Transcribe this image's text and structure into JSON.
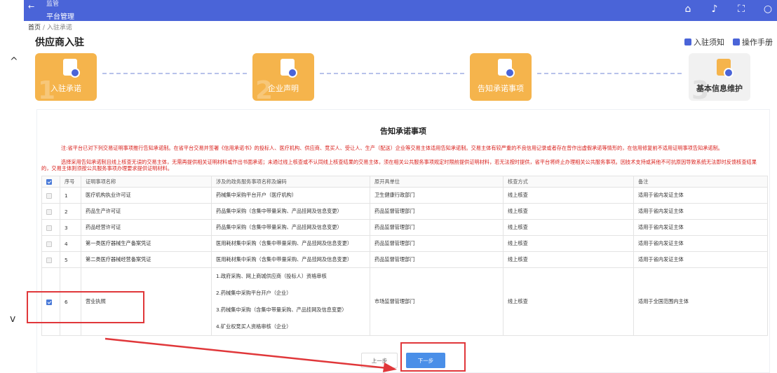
{
  "header": {
    "back_icon": "arrow-left-icon",
    "system_top": "监管",
    "system_name": "平台管理",
    "tools": [
      "home-icon",
      "bell-icon",
      "fullscreen-icon",
      "search-icon"
    ]
  },
  "breadcrumb": {
    "home": "首页",
    "sep": "/",
    "current": "入驻承诺"
  },
  "page_title": "供应商入驻",
  "links": [
    {
      "label": "入驻须知",
      "icon": "notice-icon"
    },
    {
      "label": "操作手册",
      "icon": "manual-icon"
    }
  ],
  "steps": [
    {
      "num": "1",
      "label": "入驻承诺",
      "icon": "commitment-icon"
    },
    {
      "num": "2",
      "label": "企业声明",
      "icon": "enterprise-icon"
    },
    {
      "num": "",
      "label": "告知承诺事项",
      "icon": "bookmark-doc-icon"
    },
    {
      "num": "3",
      "label": "基本信息维护",
      "icon": "info-doc-icon"
    }
  ],
  "card": {
    "title": "告知承诺事项",
    "notice_1": "注:省平台已对下列交易证明事项推行告知承诺制。在省平台交易并签署《信用承诺书》的投标人、医疗机构、供应商、竞买人、受让人、生产（配送）企业等交易主体适用告知承诺制。交易主体有较严重的不良信用记录或者存在曾作出虚假承诺等情形的，在信用修复前不适用证明事项告知承诺制。",
    "notice_2": "选择采用告知承诺制且线上核查无误的交易主体，无需再提供相关证明材料或作出书面承诺；未通过线上核查或不认同线上核查结果的交易主体，须在相关公共服务事项规定时限前提供证明材料，若无法按时提供，省平台将终止办理相关公共服务事项。因技术支持或其他不可抗原因导致系统无法即时反馈核查结果的，交易主体则须按公共服务事项办理要求提供证明材料。"
  },
  "table": {
    "headers": [
      "序号",
      "证明事项名称",
      "涉及的政务服务事项名称及编码",
      "原开具单位",
      "核查方式",
      "备注"
    ],
    "rows": [
      {
        "no": "1",
        "name": "医疗机构执业许可证",
        "items": [
          "药械集中采购平台开户（医疗机构）"
        ],
        "unit": "卫生健康行政部门",
        "method": "线上核查",
        "remark": "适用于省内发证主体",
        "checked": false
      },
      {
        "no": "2",
        "name": "药品生产许可证",
        "items": [
          "药品集中采购（含集中带量采购、产品挂网及信息变更）"
        ],
        "unit": "药品监督管理部门",
        "method": "线上核查",
        "remark": "适用于省内发证主体",
        "checked": false
      },
      {
        "no": "3",
        "name": "药品经营许可证",
        "items": [
          "药品集中采购（含集中带量采购、产品挂网及信息变更）"
        ],
        "unit": "药品监督管理部门",
        "method": "线上核查",
        "remark": "适用于省内发证主体",
        "checked": false
      },
      {
        "no": "4",
        "name": "第一类医疗器械生产备案凭证",
        "items": [
          "医用耗材集中采购（含集中带量采购、产品挂网及信息变更）"
        ],
        "unit": "药品监督管理部门",
        "method": "线上核查",
        "remark": "适用于省内发证主体",
        "checked": false
      },
      {
        "no": "5",
        "name": "第二类医疗器械经营备案凭证",
        "items": [
          "医用耗材集中采购（含集中带量采购、产品挂网及信息变更）"
        ],
        "unit": "药品监督管理部门",
        "method": "线上核查",
        "remark": "适用于省内发证主体",
        "checked": false
      },
      {
        "no": "6",
        "name": "营业执照",
        "items": [
          "1.政府采购、网上商城供应商（投标人）资格审核",
          "2.药械集中采购平台开户（企业）",
          "3.药械集中采购（含集中带量采购、产品挂网及信息变更）",
          "4.矿业权竞买人资格审核（企业）"
        ],
        "unit": "市场监督管理部门",
        "method": "线上核查",
        "remark": "适用于全国范围内主体",
        "checked": true
      }
    ]
  },
  "buttons": {
    "prev": "上一步",
    "next": "下一步"
  },
  "colors": {
    "primary": "#4a64d8",
    "step_active": "#f5b44c",
    "notice_red": "#d9201c",
    "annotation_red": "#e0373a"
  }
}
